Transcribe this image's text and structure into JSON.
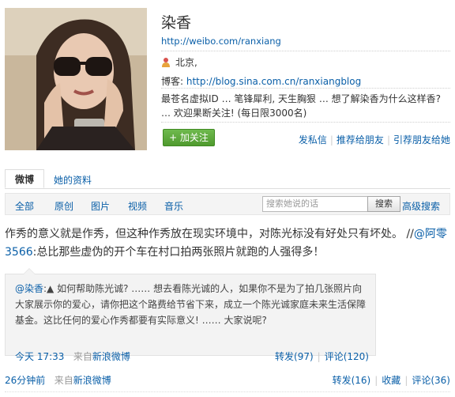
{
  "profile": {
    "name": "染香",
    "url": "http://weibo.com/ranxiang",
    "location": "北京,",
    "blog_label": "博客:",
    "blog_url": "http://blog.sina.com.cn/ranxiangblog",
    "bio_line1": "最苍名虚拟ID … 笔锋犀利, 天生胸狠 … 想了解染香为什么这样香?",
    "bio_line2": "… 欢迎果断关注! (每日限3000名)",
    "follow_label": "+ 加关注",
    "actions": [
      "发私信",
      "推荐给朋友",
      "引荐朋友给她"
    ]
  },
  "tabs": [
    "微博",
    "她的资料"
  ],
  "filter": {
    "items": [
      "全部",
      "原创",
      "图片",
      "视频",
      "音乐"
    ],
    "search_placeholder": "搜索她说的话",
    "search_button": "搜索",
    "advanced": "高级搜索"
  },
  "post": {
    "text_main": "作秀的意义就是作秀，但这种作秀放在现实环境中，对陈光标没有好处只有坏处。 //",
    "text_mention": "@阿零3566",
    "text_rest": ":总比那些虚伪的开个车在村口拍两张照片就跑的人强得多！",
    "quote": {
      "author": "@染香",
      "text": ":▲ 如何帮助陈光诚? …… 想去看陈光诚的人，如果你不是为了拍几张照片向大家展示你的爱心，请你把这个路费给节省下来，成立一个陈光诚家庭未来生活保障基金。这比任何的爱心作秀都要有实际意义! …… 大家说呢?",
      "time": "今天 17:33",
      "source_prefix": "来自",
      "source": "新浪微博",
      "repost": "转发(97)",
      "comment": "评论(120)"
    },
    "time": "26分钟前",
    "source_prefix": "来自",
    "source": "新浪微博",
    "repost": "转发(16)",
    "favorite": "收藏",
    "comment": "评论(36)"
  },
  "colors": {
    "link": "#0a5fa8",
    "follow_green": "#5aa838"
  }
}
